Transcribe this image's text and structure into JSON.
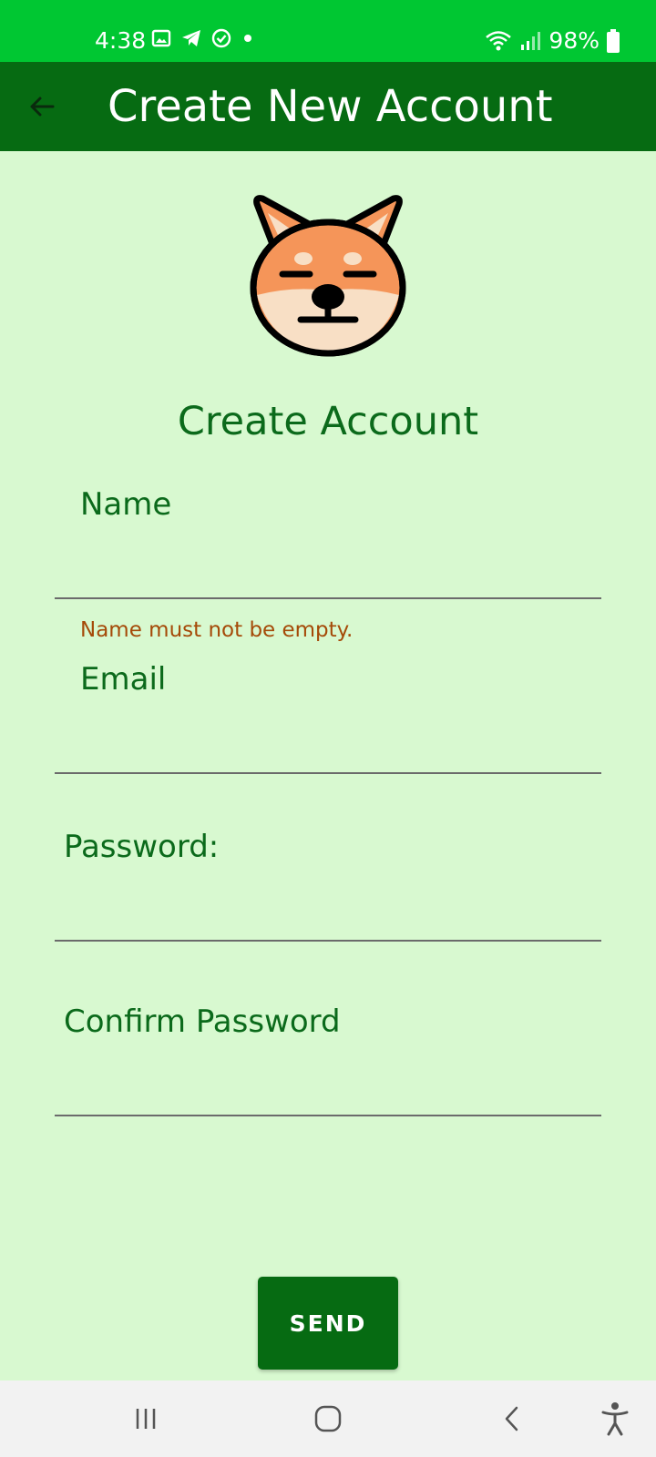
{
  "status_bar": {
    "time": "4:38",
    "battery": "98%",
    "icons": [
      "gallery-icon",
      "telegram-icon",
      "check-circle-icon",
      "dot-icon",
      "wifi-icon",
      "signal-icon",
      "battery-icon"
    ]
  },
  "app_bar": {
    "title": "Create New Account",
    "back_icon": "arrow-back-icon"
  },
  "logo": {
    "icon": "shiba-dog-icon"
  },
  "form": {
    "title": "Create Account",
    "name_label": "Name",
    "name_value": "",
    "name_error": "Name must not be empty.",
    "email_label": "Email",
    "email_value": "",
    "password_label": "Password:",
    "password_value": "",
    "confirm_label": "Confirm Password",
    "confirm_value": ""
  },
  "send_label": "SEND",
  "nav": {
    "icons": [
      "recents-icon",
      "home-icon",
      "back-icon",
      "accessibility-icon"
    ]
  },
  "colors": {
    "status_bar": "#00c732",
    "app_bar": "#066b12",
    "background": "#d8f9d0",
    "label": "#0b6a1b",
    "error": "#a54a08",
    "nav_bar": "#f2f2f2"
  }
}
